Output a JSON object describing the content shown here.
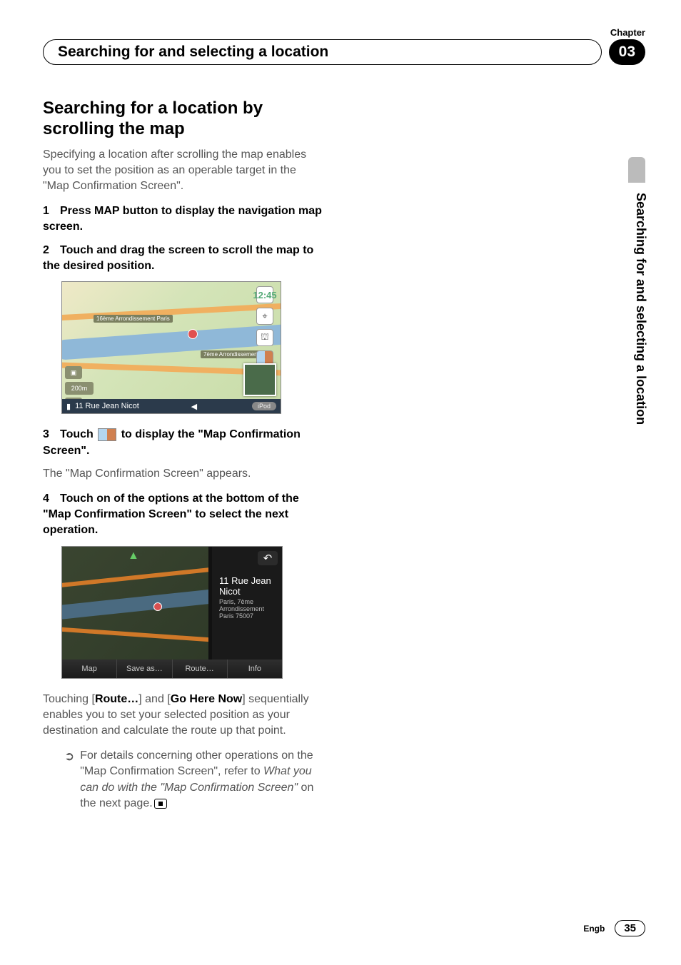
{
  "chapterLabel": "Chapter",
  "chapterNumber": "03",
  "headerTitle": "Searching for and selecting a location",
  "sideTab": "Searching for and selecting a location",
  "sectionTitle": "Searching for a location by scrolling the map",
  "intro": "Specifying a location after scrolling the map enables you to set the position as an operable target in the \"Map Confirmation Screen\".",
  "step1": {
    "num": "1",
    "text": "Press MAP button to display the navigation map screen."
  },
  "step2": {
    "num": "2",
    "text": "Touch and drag the screen to scroll the map to the desired position."
  },
  "mapShot": {
    "timeLabel": "12:45",
    "label1": "16ème Arrondissement Paris",
    "label2": "7ème Arrondissement",
    "scale": "200m",
    "bottomAddress": "11 Rue Jean Nicot",
    "ipod": "iPod"
  },
  "step3a": "Touch ",
  "step3b": " to display the \"Map Confirmation Screen\".",
  "step3num": "3",
  "step3follow": "The \"Map Confirmation Screen\" appears.",
  "step4": {
    "num": "4",
    "text": "Touch on of the options at the bottom of the \"Map Confirmation Screen\" to select the next operation."
  },
  "confShot": {
    "addrLine1": "11 Rue Jean Nicot",
    "addrLine2": "Paris, 7ème Arrondissement Paris 75007",
    "buttons": [
      "Map",
      "Save as…",
      "Route…",
      "Info"
    ]
  },
  "para2a": "Touching [",
  "para2b": "Route…",
  "para2c": "] and [",
  "para2d": "Go Here Now",
  "para2e": "] sequentially enables you to set your selected position as your destination and calculate the route up that point.",
  "bullet1a": "For details concerning other operations on the \"Map Confirmation Screen\", refer to ",
  "bullet1b": "What you can do with the \"Map Confirmation Screen\"",
  "bullet1c": " on the next page.",
  "footerLang": "Engb",
  "footerPage": "35"
}
